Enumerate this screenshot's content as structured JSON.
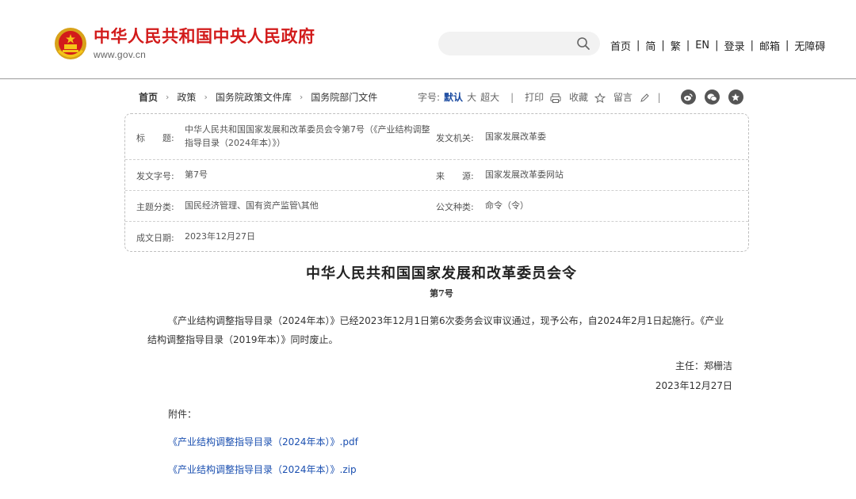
{
  "header": {
    "site_title": "中华人民共和国中央人民政府",
    "site_url": "www.gov.cn",
    "search_placeholder": "",
    "nav": [
      "首页",
      "简",
      "繁",
      "EN",
      "登录",
      "邮箱",
      "无障碍"
    ]
  },
  "breadcrumb": [
    "首页",
    "政策",
    "国务院政策文件库",
    "国务院部门文件"
  ],
  "tools": {
    "font_label": "字号:",
    "font_sizes": [
      "默认",
      "大",
      "超大"
    ],
    "print": "打印",
    "favorite": "收藏",
    "comment": "留言"
  },
  "meta": {
    "title_label": "标　　题:",
    "title_value_line1": "中华人民共和国国家发展和改革委员会令第7号（《产业结构调整",
    "title_value_line2": "指导目录（2024年本）》）",
    "issuer_label": "发文机关:",
    "issuer_value": "国家发展改革委",
    "doc_no_label": "发文字号:",
    "doc_no_value": "第7号",
    "source_label": "来　　源:",
    "source_value": "国家发展改革委网站",
    "topic_label": "主题分类:",
    "topic_value": "国民经济管理、国有资产监管\\其他",
    "type_label": "公文种类:",
    "type_value": "命令（令）",
    "date_label": "成文日期:",
    "date_value": "2023年12月27日"
  },
  "article": {
    "title": "中华人民共和国国家发展和改革委员会令",
    "number": "第7号",
    "body": "《产业结构调整指导目录（2024年本）》已经2023年12月1日第6次委务会议审议通过，现予公布，自2024年2月1日起施行。《产业结构调整指导目录（2019年本）》同时废止。",
    "signer": "主任：郑栅洁",
    "date": "2023年12月27日",
    "attachment_label": "附件：",
    "attachments": [
      "《产业结构调整指导目录（2024年本）》.pdf",
      "《产业结构调整指导目录（2024年本）》.zip"
    ]
  },
  "colors": {
    "brand_red": "#d21b1b",
    "link_blue": "#1a4fb0",
    "active_blue": "#1a4aa0"
  }
}
